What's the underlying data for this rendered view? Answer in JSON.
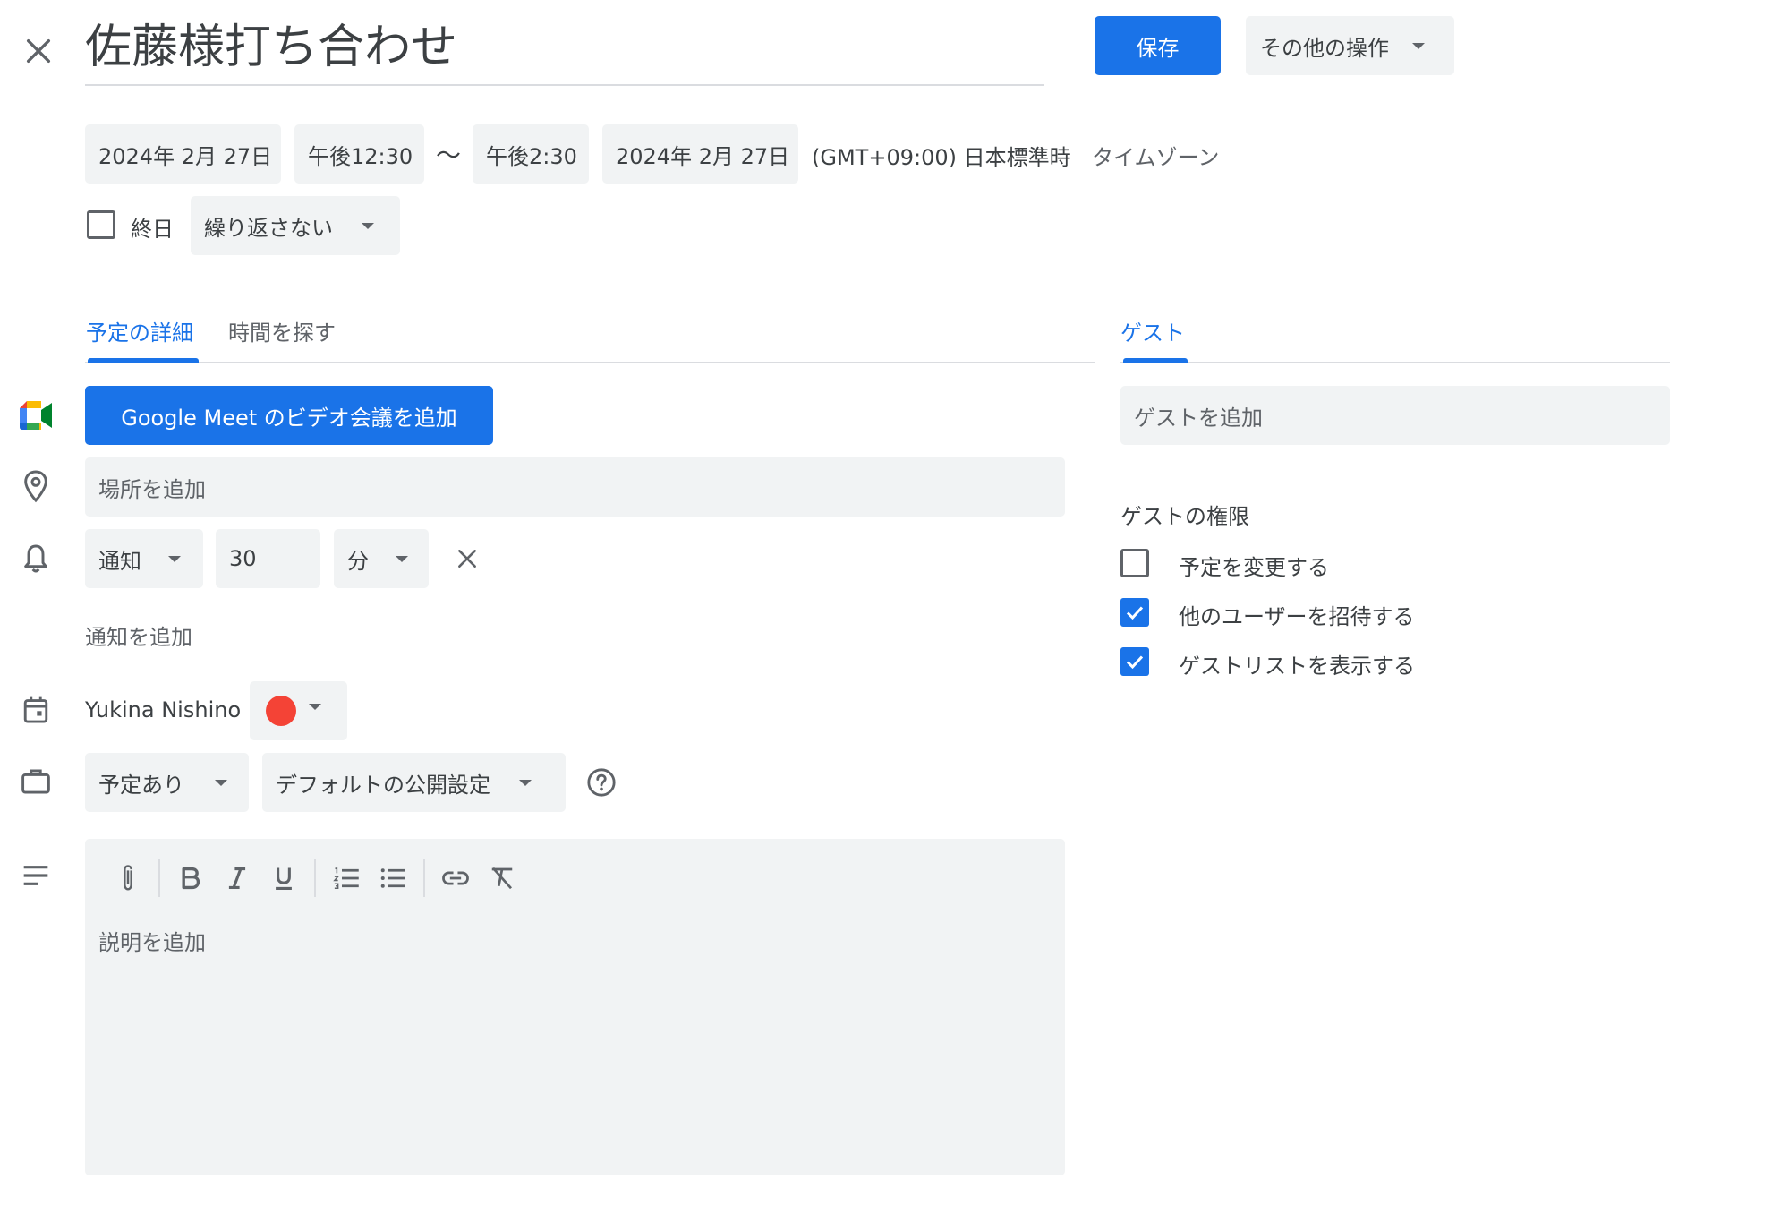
{
  "header": {
    "title": "佐藤様打ち合わせ",
    "save_label": "保存",
    "more_actions_label": "その他の操作"
  },
  "datetime": {
    "start_date": "2024年 2月 27日",
    "start_time": "午後12:30",
    "separator": "〜",
    "end_time": "午後2:30",
    "end_date": "2024年 2月 27日",
    "timezone_value": "(GMT+09:00) 日本標準時",
    "timezone_link": "タイムゾーン",
    "all_day_label": "終日",
    "repeat_label": "繰り返さない"
  },
  "tabs": {
    "details": "予定の詳細",
    "find_time": "時間を探す",
    "guests": "ゲスト"
  },
  "details": {
    "meet_button": "Google Meet のビデオ会議を追加",
    "location_placeholder": "場所を追加",
    "notification_type": "通知",
    "notification_value": "30",
    "notification_unit": "分",
    "add_notification": "通知を追加",
    "calendar_owner": "Yukina Nishino",
    "calendar_color": "#f44336",
    "availability": "予定あり",
    "visibility": "デフォルトの公開設定",
    "description_placeholder": "説明を追加"
  },
  "guests": {
    "add_placeholder": "ゲストを追加",
    "permissions_title": "ゲストの権限",
    "permissions": [
      {
        "label": "予定を変更する",
        "checked": false
      },
      {
        "label": "他のユーザーを招待する",
        "checked": true
      },
      {
        "label": "ゲストリストを表示する",
        "checked": true
      }
    ]
  },
  "colors": {
    "accent": "#1a73e8",
    "field_bg": "#f1f3f4"
  },
  "icons": [
    "close-icon",
    "meet-icon",
    "location-icon",
    "bell-icon",
    "calendar-icon",
    "briefcase-icon",
    "description-icon",
    "help-icon",
    "attach-icon",
    "bold-icon",
    "italic-icon",
    "underline-icon",
    "numbered-list-icon",
    "bullet-list-icon",
    "link-icon",
    "clear-format-icon",
    "check-icon"
  ]
}
